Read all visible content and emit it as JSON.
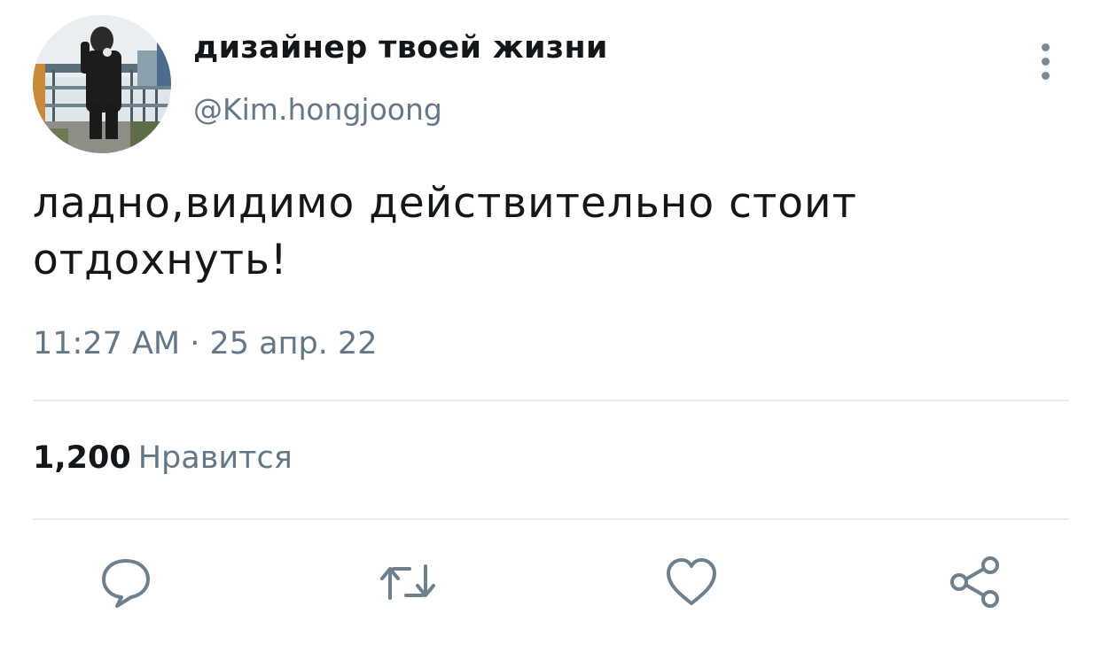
{
  "tweet": {
    "author": {
      "display_name": "дизайнер твоей жизни",
      "handle": "@Kim.hongjoong",
      "avatar_icon": "profile-photo"
    },
    "text": "ладно,видимо действительно стоит отдохнуть!",
    "timestamp": "11:27 AM · 25 апр. 22",
    "likes": {
      "count": "1,200",
      "label": "Нравится"
    },
    "actions": [
      {
        "name": "reply",
        "icon": "speech-bubble-icon"
      },
      {
        "name": "retweet",
        "icon": "retweet-arrows-icon"
      },
      {
        "name": "like",
        "icon": "heart-icon"
      },
      {
        "name": "share",
        "icon": "share-nodes-icon"
      }
    ]
  },
  "colors": {
    "text_primary": "#14171a",
    "text_secondary": "#657786",
    "divider": "#e6ecf0",
    "icon": "#6e7f8d"
  }
}
